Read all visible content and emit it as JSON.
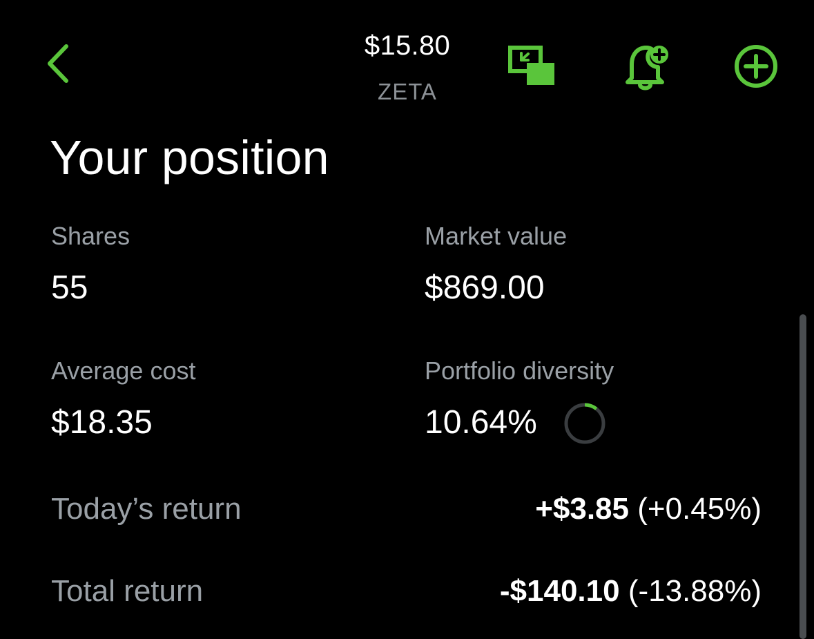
{
  "header": {
    "price": "$15.80",
    "ticker": "ZETA",
    "icons": {
      "back": "chevron-left-icon",
      "pip": "picture-in-picture-icon",
      "alert": "bell-plus-icon",
      "add": "plus-circle-icon"
    }
  },
  "position": {
    "title": "Your position",
    "shares_label": "Shares",
    "shares_value": "55",
    "market_label": "Market value",
    "market_value": "$869.00",
    "avg_cost_label": "Average cost",
    "avg_cost_value": "$18.35",
    "diversity_label": "Portfolio diversity",
    "diversity_value": "10.64%",
    "diversity_fraction": 0.1064
  },
  "returns": {
    "today_label": "Today’s return",
    "today_amount": "+$3.85",
    "today_percent": "(+0.45%)",
    "total_label": "Total return",
    "total_amount": "-$140.10",
    "total_percent": "(-13.88%)"
  },
  "colors": {
    "accent": "#5ac53b",
    "background": "#000000",
    "text_primary": "#ffffff",
    "text_secondary": "#9aa0a6",
    "ring_track": "#3a3d40"
  }
}
